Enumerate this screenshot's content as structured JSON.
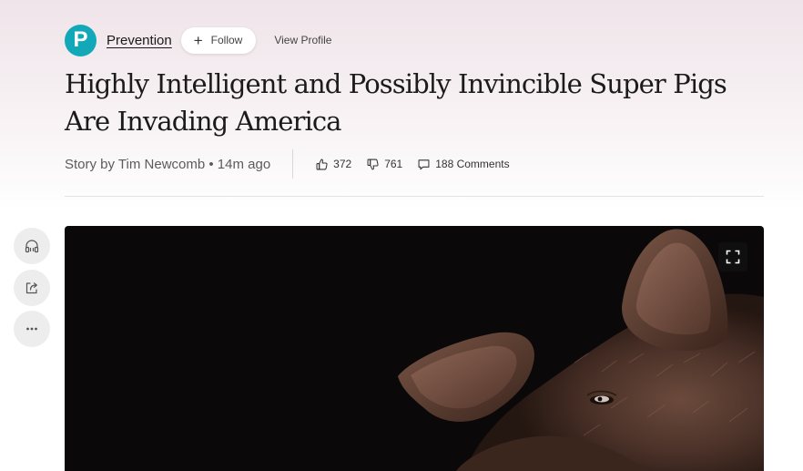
{
  "publisher": {
    "logo_letter": "P",
    "logo_color": "#12a8b8",
    "name": "Prevention",
    "follow_label": "Follow",
    "view_profile_label": "View Profile"
  },
  "article": {
    "title": "Highly Intelligent and Possibly Invincible Super Pigs Are Invading America",
    "byline": "Story by Tim Newcomb • 14m ago"
  },
  "reactions": {
    "likes": "372",
    "dislikes": "761",
    "comments": "188 Comments"
  },
  "rail": {
    "icons": [
      "headphones-icon",
      "share-icon",
      "more-icon"
    ]
  },
  "hero": {
    "subject": "pig-photo",
    "expand_icon": "fullscreen-icon"
  }
}
